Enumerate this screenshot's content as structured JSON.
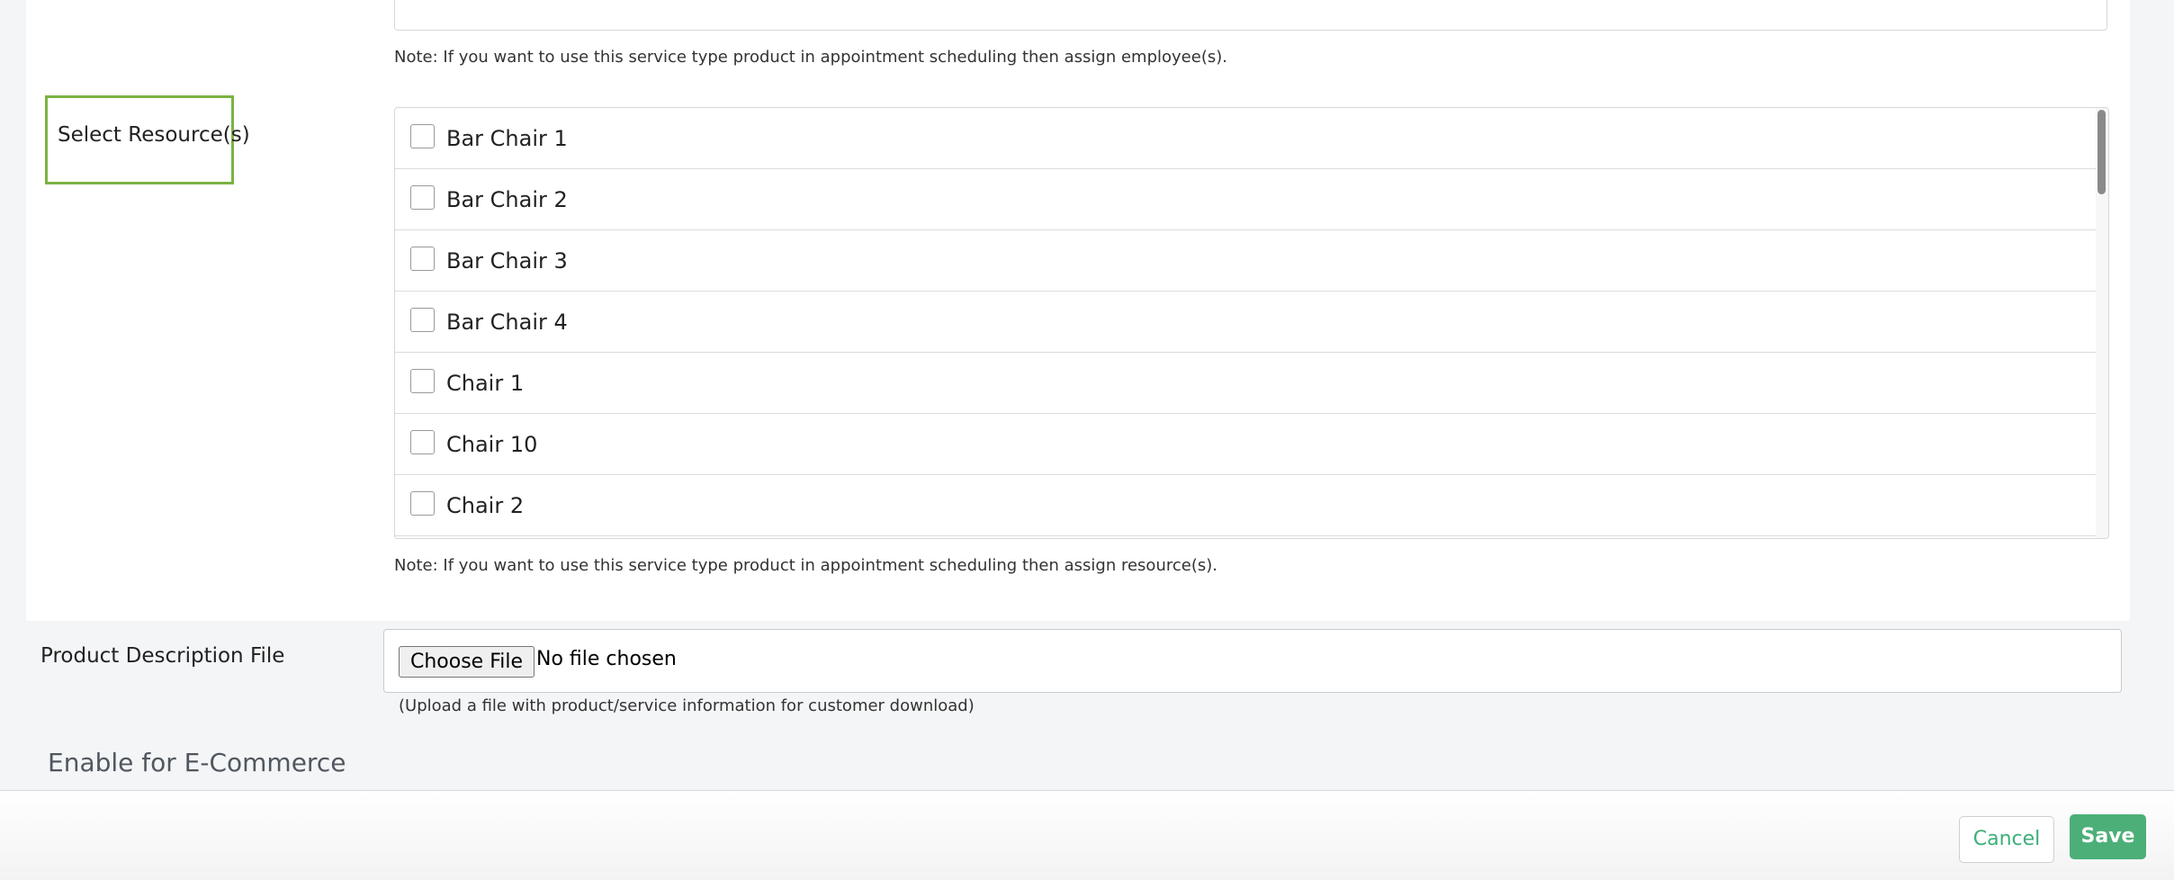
{
  "employees_note": "Note: If you want to use this service type product in appointment scheduling then assign employee(s).",
  "resources": {
    "label": "Select Resource(s)",
    "items": [
      {
        "label": "Bar Chair 1",
        "checked": false
      },
      {
        "label": "Bar Chair 2",
        "checked": false
      },
      {
        "label": "Bar Chair 3",
        "checked": false
      },
      {
        "label": "Bar Chair 4",
        "checked": false
      },
      {
        "label": "Chair 1",
        "checked": false
      },
      {
        "label": "Chair 10",
        "checked": false
      },
      {
        "label": "Chair 2",
        "checked": false
      }
    ],
    "note": "Note: If you want to use this service type product in appointment scheduling then assign resource(s)."
  },
  "product_description_file": {
    "label": "Product Description File",
    "button_label": "Choose File",
    "status": "No file chosen",
    "hint": "(Upload a file with product/service information for customer download)"
  },
  "ecommerce": {
    "heading": "Enable for E-Commerce"
  },
  "footer": {
    "cancel_label": "Cancel",
    "save_label": "Save"
  },
  "colors": {
    "highlight_border": "#7cb342",
    "save_button": "#4caf78",
    "cancel_text": "#3cae7a"
  }
}
